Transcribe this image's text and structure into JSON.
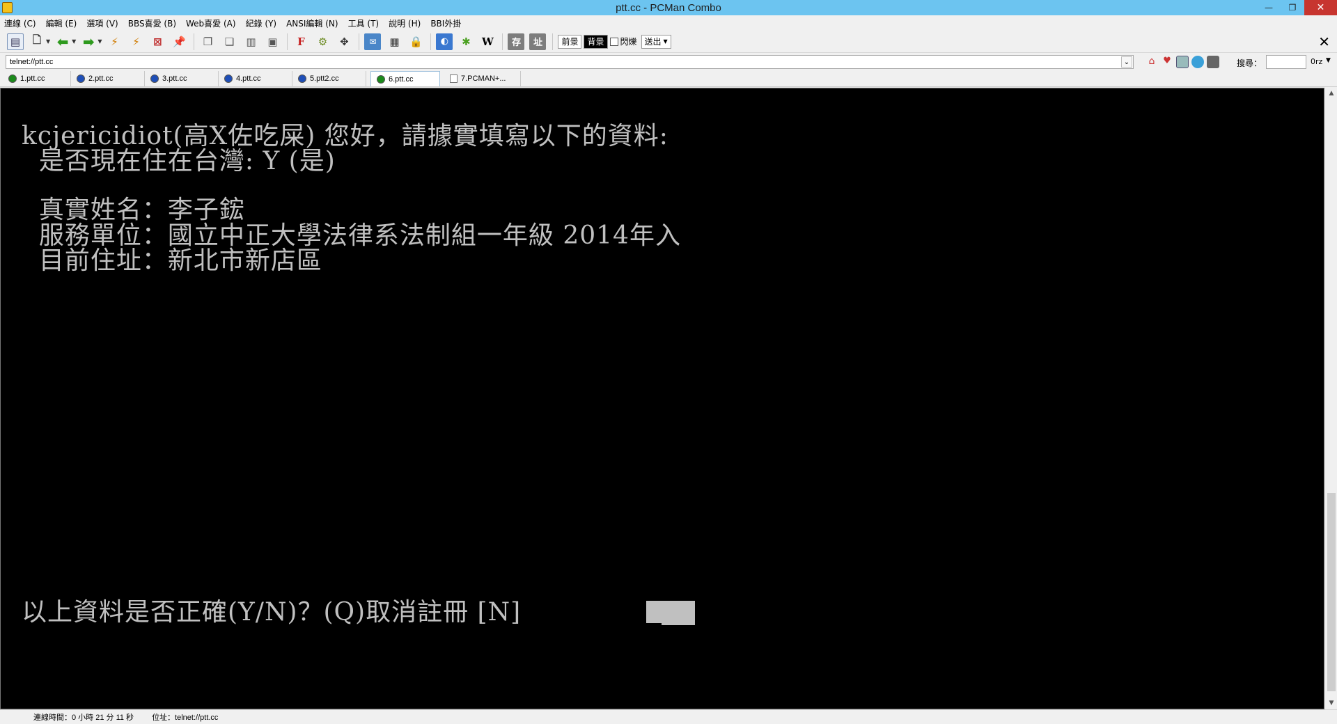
{
  "window": {
    "title": "ptt.cc - PCMan Combo"
  },
  "menu": [
    "連線 (C)",
    "編輯 (E)",
    "選項 (V)",
    "BBS喜愛 (B)",
    "Web喜愛 (A)",
    "紀錄 (Y)",
    "ANSI編輯 (N)",
    "工具 (T)",
    "說明 (H)",
    "BBI外掛"
  ],
  "toolbar": {
    "fg_label": "前景",
    "bg_label": "背景",
    "blink_label": "閃爍",
    "send_label": "送出",
    "save_label": "存",
    "addr_label": "址",
    "w_label": "W",
    "f_label": "F"
  },
  "address": {
    "value": "telnet://ptt.cc"
  },
  "search": {
    "label": "搜尋：",
    "engine": "0rz"
  },
  "tabs": [
    {
      "label": "1.ptt.cc",
      "color": "#1b8a1b"
    },
    {
      "label": "2.ptt.cc",
      "color": "#1f4fb8"
    },
    {
      "label": "3.ptt.cc",
      "color": "#1f4fb8"
    },
    {
      "label": "4.ptt.cc",
      "color": "#1f4fb8"
    },
    {
      "label": "5.ptt2.cc",
      "color": "#1f4fb8"
    },
    {
      "label": "6.ptt.cc",
      "color": "#1b8a1b"
    },
    {
      "label": "7.PCMAN+..."
    }
  ],
  "terminal": {
    "greeting": "kcjericidiot(高X佐吃屎) 您好，請據實填寫以下的資料:",
    "residence": "  是否現在住在台灣: Y (是)",
    "real_name": "  真實姓名：李子鋐",
    "organization": "  服務單位：國立中正大學法律系法制組一年級 2014年入",
    "address": "  目前住址：新北市新店區",
    "prompt": "以上資料是否正確(Y/N)？(Q)取消註冊 [N] "
  },
  "status": {
    "connection_time": "連線時間：0 小時 21 分 11 秒",
    "location": "位址：telnet://ptt.cc"
  }
}
